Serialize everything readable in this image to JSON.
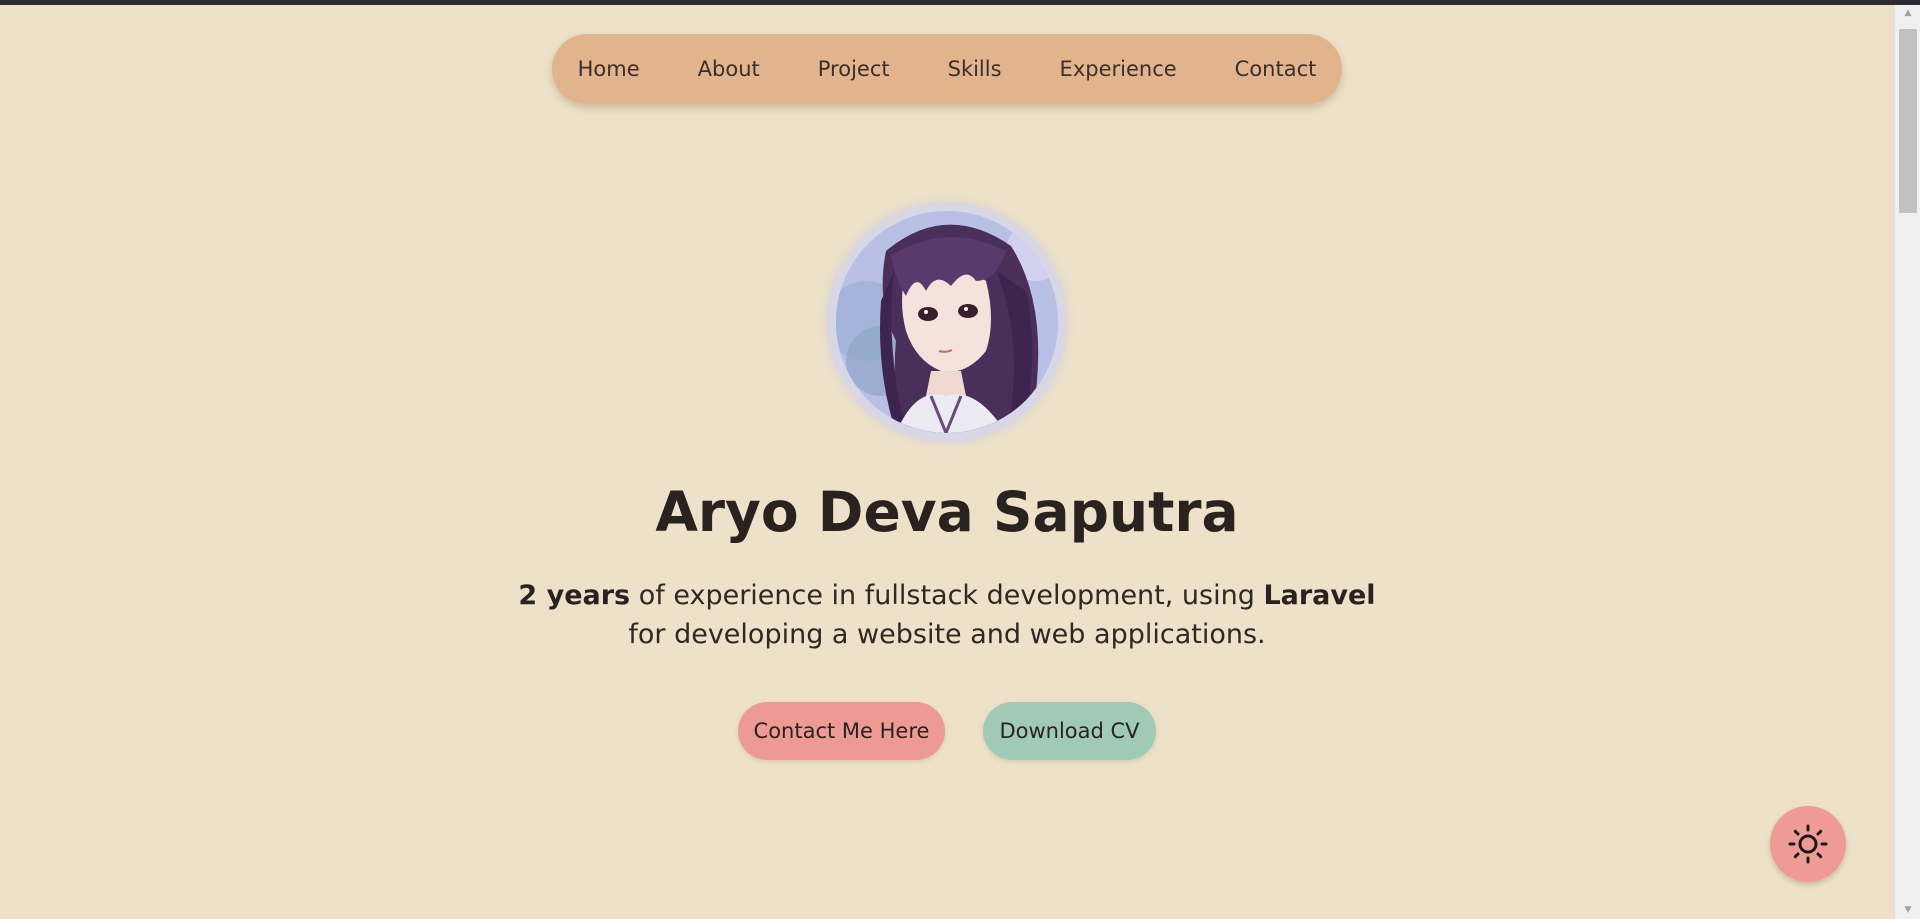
{
  "nav": {
    "items": [
      {
        "label": "Home"
      },
      {
        "label": "About"
      },
      {
        "label": "Project"
      },
      {
        "label": "Skills"
      },
      {
        "label": "Experience"
      },
      {
        "label": "Contact"
      }
    ]
  },
  "hero": {
    "avatar_icon": "anime-character-avatar",
    "name": "Aryo Deva Saputra",
    "tagline": {
      "strong1": "2 years",
      "text1": " of experience in fullstack development, using ",
      "strong2": "Laravel",
      "text2": " for developing a website and web applications."
    },
    "contact_button": "Contact Me Here",
    "cv_button": "Download CV"
  },
  "theme_toggle": {
    "icon": "sun-icon"
  },
  "colors": {
    "background": "#ede2c9",
    "nav_bg": "#e2b48d",
    "contact_btn": "#ee9a94",
    "cv_btn": "#a0cab5",
    "toggle_bg": "#ef9a95"
  }
}
